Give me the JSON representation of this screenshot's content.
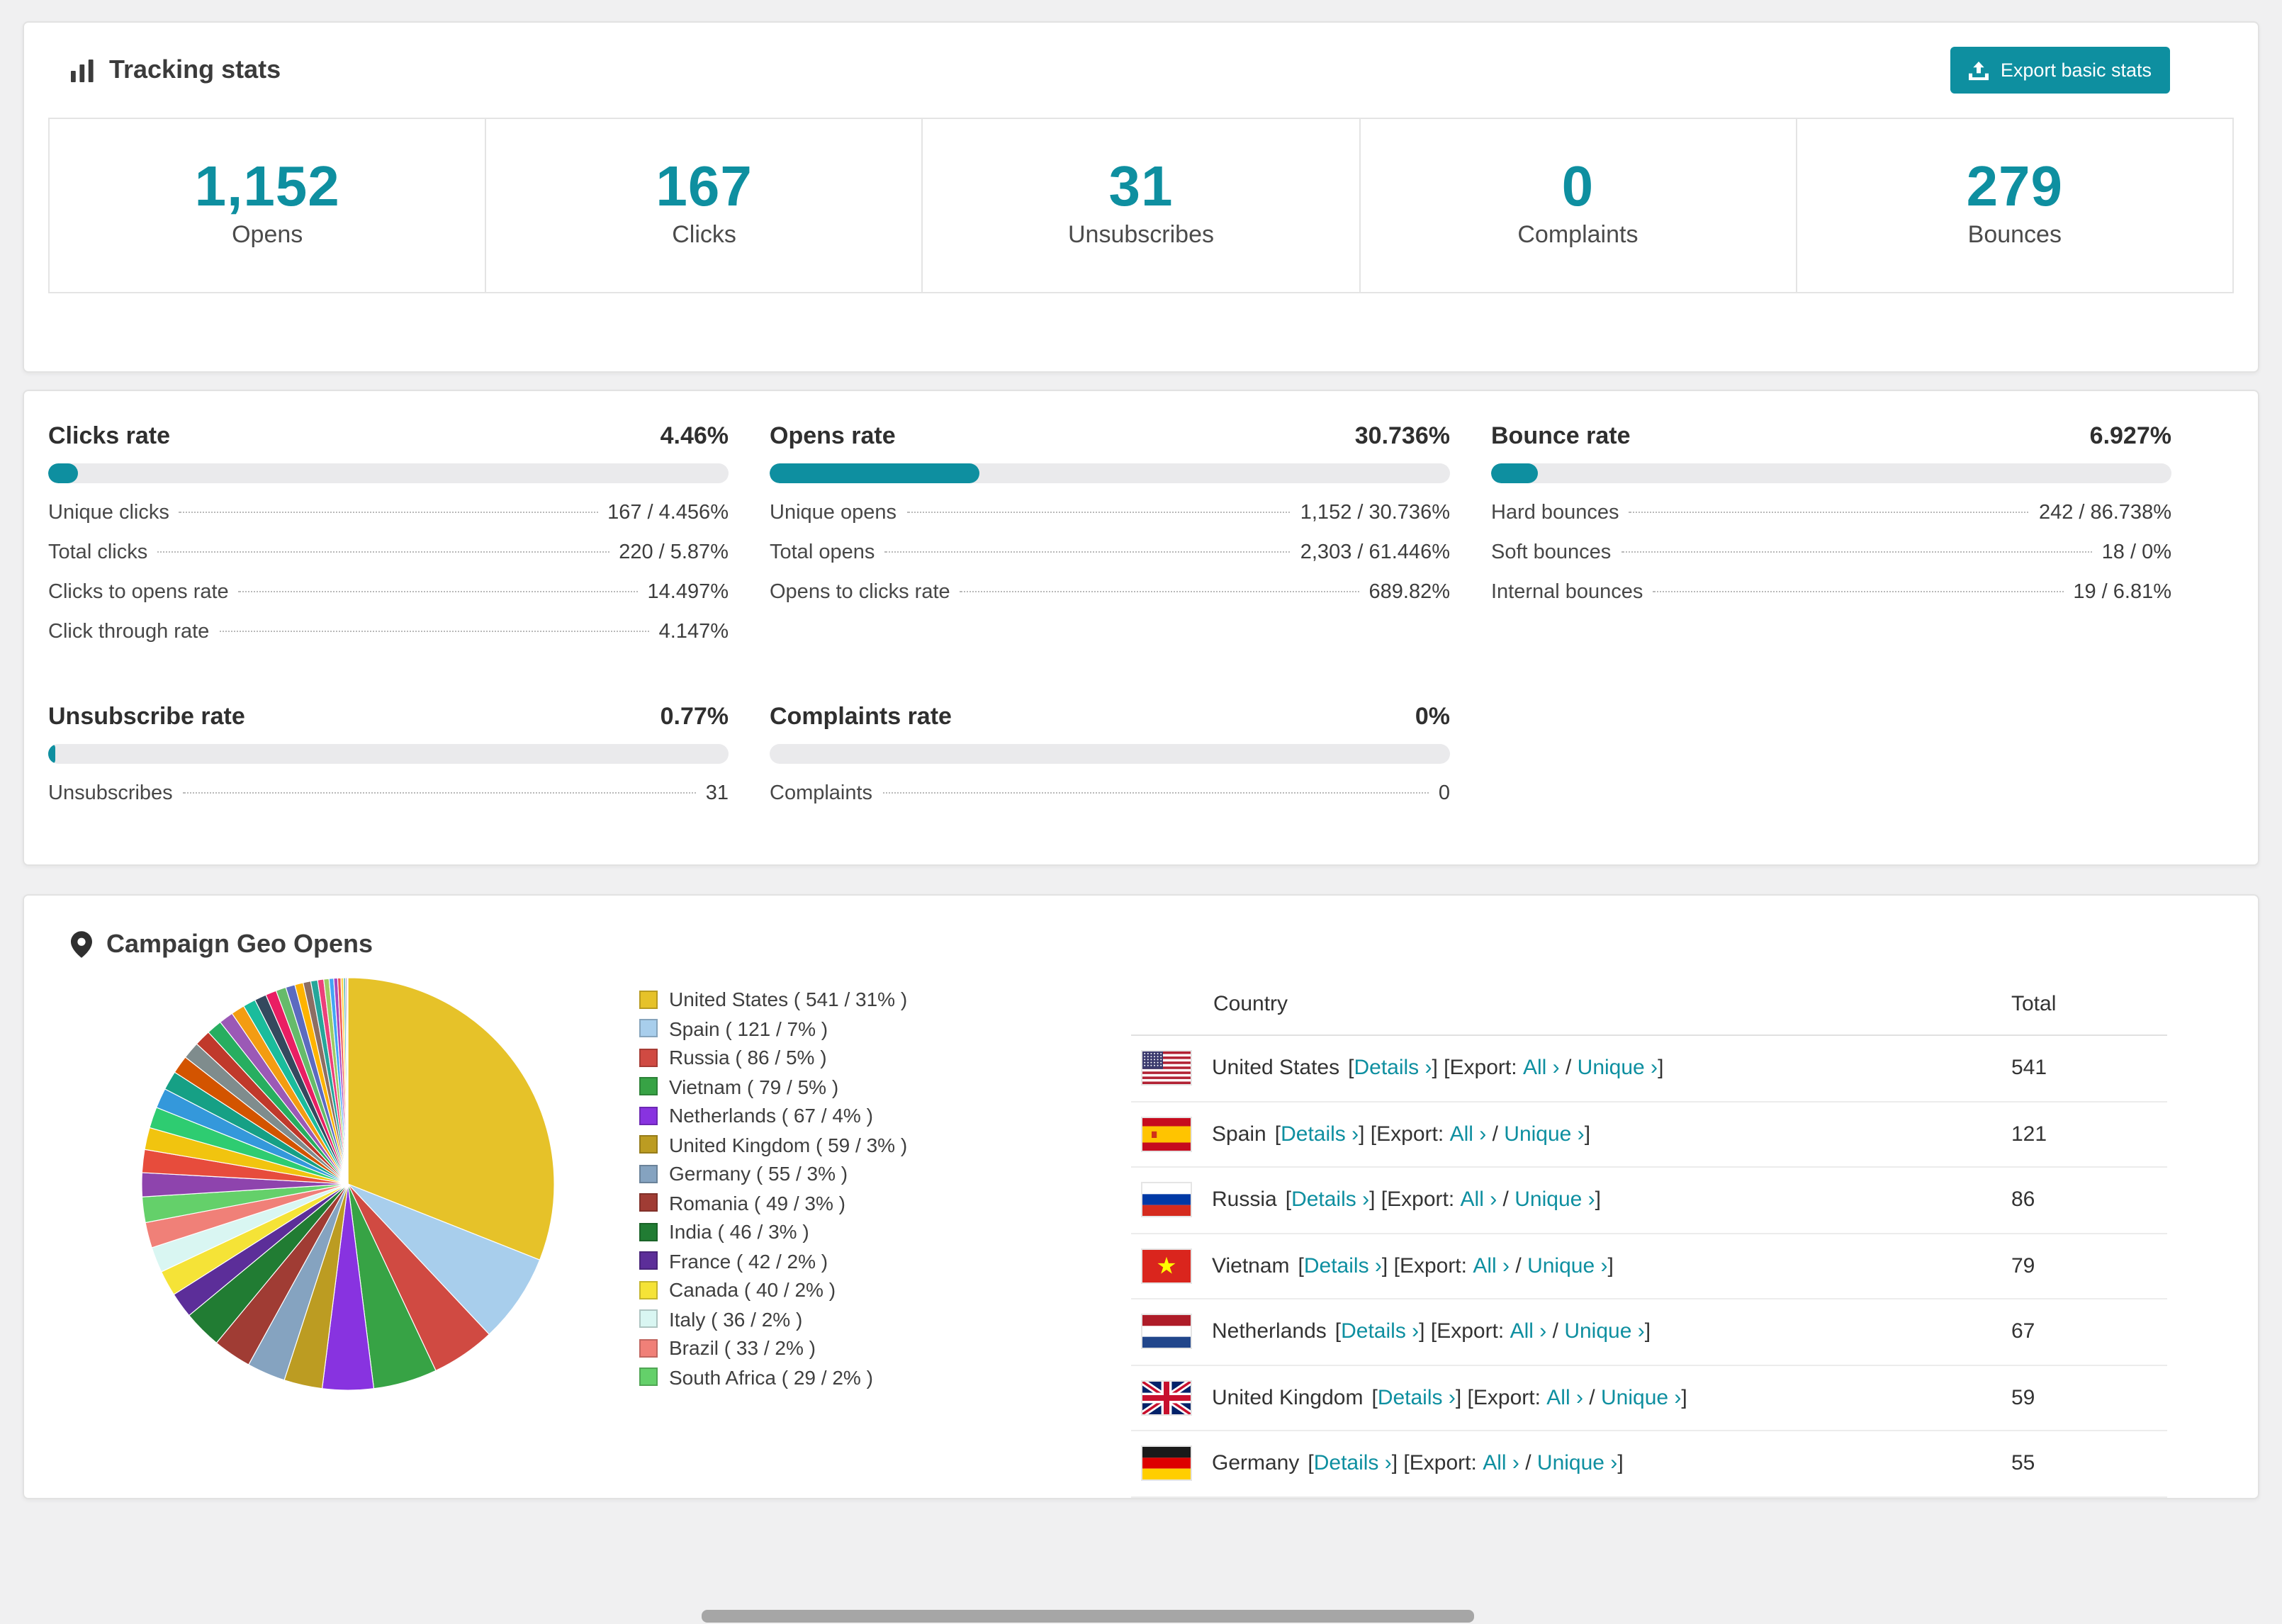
{
  "colors": {
    "accent": "#0E8FA0"
  },
  "tracking": {
    "title": "Tracking stats",
    "export_button": "Export basic stats",
    "stats": [
      {
        "value": "1,152",
        "label": "Opens"
      },
      {
        "value": "167",
        "label": "Clicks"
      },
      {
        "value": "31",
        "label": "Unsubscribes"
      },
      {
        "value": "0",
        "label": "Complaints"
      },
      {
        "value": "279",
        "label": "Bounces"
      }
    ]
  },
  "rates": [
    {
      "title": "Clicks rate",
      "value": "4.46%",
      "percent": 4.46,
      "rows": [
        {
          "label": "Unique clicks",
          "value": "167 / 4.456%"
        },
        {
          "label": "Total clicks",
          "value": "220 / 5.87%"
        },
        {
          "label": "Clicks to opens rate",
          "value": "14.497%"
        },
        {
          "label": "Click through rate",
          "value": "4.147%"
        }
      ]
    },
    {
      "title": "Opens rate",
      "value": "30.736%",
      "percent": 30.736,
      "rows": [
        {
          "label": "Unique opens",
          "value": "1,152 / 30.736%"
        },
        {
          "label": "Total opens",
          "value": "2,303 / 61.446%"
        },
        {
          "label": "Opens to clicks rate",
          "value": "689.82%"
        }
      ]
    },
    {
      "title": "Bounce rate",
      "value": "6.927%",
      "percent": 6.927,
      "rows": [
        {
          "label": "Hard bounces",
          "value": "242 / 86.738%"
        },
        {
          "label": "Soft bounces",
          "value": "18 / 0%"
        },
        {
          "label": "Internal bounces",
          "value": "19 / 6.81%"
        }
      ]
    },
    {
      "title": "Unsubscribe rate",
      "value": "0.77%",
      "percent": 0.77,
      "rows": [
        {
          "label": "Unsubscribes",
          "value": "31"
        }
      ]
    },
    {
      "title": "Complaints rate",
      "value": "0%",
      "percent": 0,
      "rows": [
        {
          "label": "Complaints",
          "value": "0"
        }
      ]
    }
  ],
  "geo": {
    "title": "Campaign Geo Opens",
    "chart_data": {
      "type": "pie",
      "title": "Campaign Geo Opens",
      "legend_position": "right",
      "slices": [
        {
          "label": "United States",
          "value": 541,
          "percent": 31,
          "color": "#E6C229"
        },
        {
          "label": "Spain",
          "value": 121,
          "percent": 7,
          "color": "#A8CEEC"
        },
        {
          "label": "Russia",
          "value": 86,
          "percent": 5,
          "color": "#D04A42"
        },
        {
          "label": "Vietnam",
          "value": 79,
          "percent": 5,
          "color": "#37A345"
        },
        {
          "label": "Netherlands",
          "value": 67,
          "percent": 4,
          "color": "#8833E0"
        },
        {
          "label": "United Kingdom",
          "value": 59,
          "percent": 3,
          "color": "#BC9C22"
        },
        {
          "label": "Germany",
          "value": 55,
          "percent": 3,
          "color": "#85A3C0"
        },
        {
          "label": "Romania",
          "value": 49,
          "percent": 3,
          "color": "#A03C34"
        },
        {
          "label": "India",
          "value": 46,
          "percent": 3,
          "color": "#217C33"
        },
        {
          "label": "France",
          "value": 42,
          "percent": 2,
          "color": "#5C2E99"
        },
        {
          "label": "Canada",
          "value": 40,
          "percent": 2,
          "color": "#F5E337"
        },
        {
          "label": "Italy",
          "value": 36,
          "percent": 2,
          "color": "#D9F6F2"
        },
        {
          "label": "Brazil",
          "value": 33,
          "percent": 2,
          "color": "#F08078"
        },
        {
          "label": "South Africa",
          "value": 29,
          "percent": 2,
          "color": "#64D06A"
        }
      ],
      "others": {
        "total_percent": 26,
        "slice_count": 30,
        "palette": [
          "#8e44ad",
          "#e74c3c",
          "#f1c40f",
          "#2ecc71",
          "#3498db",
          "#16a085",
          "#d35400",
          "#7f8c8d",
          "#c0392b",
          "#27ae60",
          "#9b59b6",
          "#f39c12",
          "#1abc9c",
          "#34495e",
          "#e91e63",
          "#66bb6a",
          "#5c6bc0",
          "#ffb300",
          "#8d6e63",
          "#26a69a",
          "#ec407a",
          "#9ccc65",
          "#42a5f5",
          "#ab47bc",
          "#ef5350",
          "#ffd54f",
          "#4db6ac",
          "#7e57c2",
          "#aeea00",
          "#ff7043"
        ]
      }
    },
    "table": {
      "headers": [
        "Country",
        "Total"
      ],
      "details_label": "Details",
      "export_label": "Export:",
      "all_label": "All",
      "unique_label": "Unique",
      "chevron": "›",
      "rows": [
        {
          "flag": "us",
          "country": "United States",
          "total": "541"
        },
        {
          "flag": "es",
          "country": "Spain",
          "total": "121"
        },
        {
          "flag": "ru",
          "country": "Russia",
          "total": "86"
        },
        {
          "flag": "vn",
          "country": "Vietnam",
          "total": "79"
        },
        {
          "flag": "nl",
          "country": "Netherlands",
          "total": "67"
        },
        {
          "flag": "gb",
          "country": "United Kingdom",
          "total": "59"
        },
        {
          "flag": "de",
          "country": "Germany",
          "total": "55"
        }
      ]
    }
  }
}
